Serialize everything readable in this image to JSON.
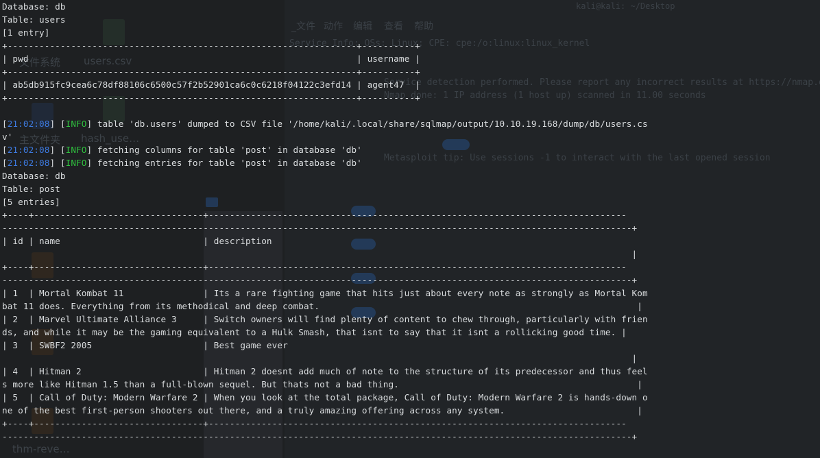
{
  "background": {
    "desktop_icons": [
      {
        "label": "文件系统"
      },
      {
        "label": "users.csv"
      },
      {
        "label": "主文件夹"
      },
      {
        "label": "hash_use…"
      },
      {
        "label": "thm-reve…"
      }
    ],
    "menu": [
      "_文件",
      "动作",
      "编辑",
      "查看",
      "帮助"
    ],
    "window_title": "kali@kali: ~/Desktop",
    "lines": [
      "Service Info: OSs: Linux; CPE: cpe:/o:linux:linux_kernel",
      "Service detection performed. Please report any incorrect results at https://nmap.org/submit/ .",
      "Nmap done: 1 IP address (1 host up) scanned in 11.00 seconds",
      "Metasploit tip: Use sessions -1 to interact with the last opened session"
    ]
  },
  "terminal": {
    "lines": [
      {
        "segments": [
          {
            "text": "Database: db"
          }
        ]
      },
      {
        "segments": [
          {
            "text": "Table: users"
          }
        ]
      },
      {
        "segments": [
          {
            "text": "[1 entry]"
          }
        ]
      },
      {
        "segments": [
          {
            "text": "+------------------------------------------------------------------+----------+"
          }
        ]
      },
      {
        "segments": [
          {
            "text": "| pwd                                                              | username |"
          }
        ]
      },
      {
        "segments": [
          {
            "text": "+------------------------------------------------------------------+----------+"
          }
        ]
      },
      {
        "segments": [
          {
            "text": "| ab5db915fc9cea6c78df88106c6500c57f2b52901ca6c0c6218f04122c3efd14 | agent47  |"
          }
        ]
      },
      {
        "segments": [
          {
            "text": "+------------------------------------------------------------------+----------+"
          }
        ]
      },
      {
        "segments": [
          {
            "text": ""
          }
        ]
      },
      {
        "segments": [
          {
            "text": "[",
            "cls": "dim"
          },
          {
            "text": "21:02:08",
            "cls": "ts"
          },
          {
            "text": "] [",
            "cls": "dim"
          },
          {
            "text": "INFO",
            "cls": "info"
          },
          {
            "text": "] table 'db.users' dumped to CSV file '/home/kali/.local/share/sqlmap/output/10.10.19.168/dump/db/users.cs",
            "cls": "dim"
          }
        ]
      },
      {
        "segments": [
          {
            "text": "v'"
          }
        ]
      },
      {
        "segments": [
          {
            "text": "[",
            "cls": "dim"
          },
          {
            "text": "21:02:08",
            "cls": "ts"
          },
          {
            "text": "] [",
            "cls": "dim"
          },
          {
            "text": "INFO",
            "cls": "info"
          },
          {
            "text": "] fetching columns for table 'post' in database 'db'",
            "cls": "dim"
          }
        ]
      },
      {
        "segments": [
          {
            "text": "[",
            "cls": "dim"
          },
          {
            "text": "21:02:08",
            "cls": "ts"
          },
          {
            "text": "] [",
            "cls": "dim"
          },
          {
            "text": "INFO",
            "cls": "info"
          },
          {
            "text": "] fetching entries for table 'post' in database 'db'",
            "cls": "dim"
          }
        ]
      },
      {
        "segments": [
          {
            "text": "Database: db"
          }
        ]
      },
      {
        "segments": [
          {
            "text": "Table: post"
          }
        ]
      },
      {
        "segments": [
          {
            "text": "[5 entries]"
          }
        ]
      },
      {
        "segments": [
          {
            "text": "+----+--------------------------------+-------------------------------------------------------------------------------"
          }
        ]
      },
      {
        "segments": [
          {
            "text": "-----------------------------------------------------------------------------------------------------------------------+"
          }
        ]
      },
      {
        "segments": [
          {
            "text": "| id | name                           | description"
          }
        ]
      },
      {
        "segments": [
          {
            "text": "                                                                                                                       |"
          }
        ]
      },
      {
        "segments": [
          {
            "text": "+----+--------------------------------+-------------------------------------------------------------------------------"
          }
        ]
      },
      {
        "segments": [
          {
            "text": "-----------------------------------------------------------------------------------------------------------------------+"
          }
        ]
      },
      {
        "segments": [
          {
            "text": "| 1  | Mortal Kombat 11               | Its a rare fighting game that hits just about every note as strongly as Mortal Kom"
          }
        ]
      },
      {
        "segments": [
          {
            "text": "bat 11 does. Everything from its methodical and deep combat.                                                            |"
          }
        ]
      },
      {
        "segments": [
          {
            "text": "| 2  | Marvel Ultimate Alliance 3     | Switch owners will find plenty of content to chew through, particularly with frien"
          }
        ]
      },
      {
        "segments": [
          {
            "text": "ds, and while it may be the gaming equivalent to a Hulk Smash, that isnt to say that it isnt a rollicking good time. |"
          }
        ]
      },
      {
        "segments": [
          {
            "text": "| 3  | SWBF2 2005                     | Best game ever"
          }
        ]
      },
      {
        "segments": [
          {
            "text": "                                                                                                                       |"
          }
        ]
      },
      {
        "segments": [
          {
            "text": "| 4  | Hitman 2                       | Hitman 2 doesnt add much of note to the structure of its predecessor and thus feel"
          }
        ]
      },
      {
        "segments": [
          {
            "text": "s more like Hitman 1.5 than a full-blown sequel. But thats not a bad thing.                                             |"
          }
        ]
      },
      {
        "segments": [
          {
            "text": "| 5  | Call of Duty: Modern Warfare 2 | When you look at the total package, Call of Duty: Modern Warfare 2 is hands-down o"
          }
        ]
      },
      {
        "segments": [
          {
            "text": "ne of the best first-person shooters out there, and a truly amazing offering across any system.                         |"
          }
        ]
      },
      {
        "segments": [
          {
            "text": "+----+--------------------------------+-------------------------------------------------------------------------------"
          }
        ]
      },
      {
        "segments": [
          {
            "text": "-----------------------------------------------------------------------------------------------------------------------+"
          }
        ]
      }
    ]
  }
}
